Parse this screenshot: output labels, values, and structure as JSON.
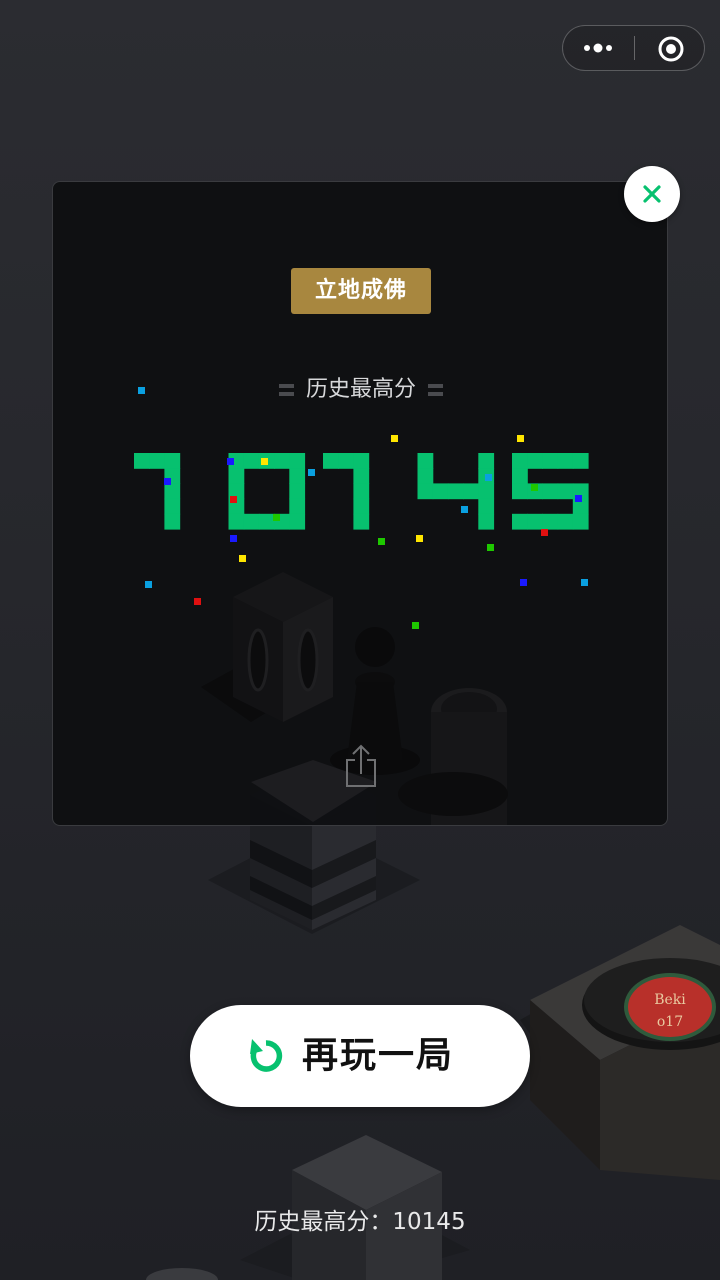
{
  "capsule": {
    "more_icon": "more-dots-icon",
    "target_icon": "target-icon"
  },
  "modal": {
    "badge": "立地成佛",
    "highscore_label": "历史最高分",
    "score_display": "10145",
    "share_icon": "share-icon",
    "close_icon": "close-icon"
  },
  "record_label": {
    "line1": "Beki",
    "line2": "o17"
  },
  "replay_button": {
    "label": "再玩一局",
    "icon": "replay-icon"
  },
  "footer": {
    "highscore_text": "历史最高分：10145"
  },
  "colors": {
    "accent_green": "#07c16f",
    "badge_gold": "#a8873f"
  }
}
